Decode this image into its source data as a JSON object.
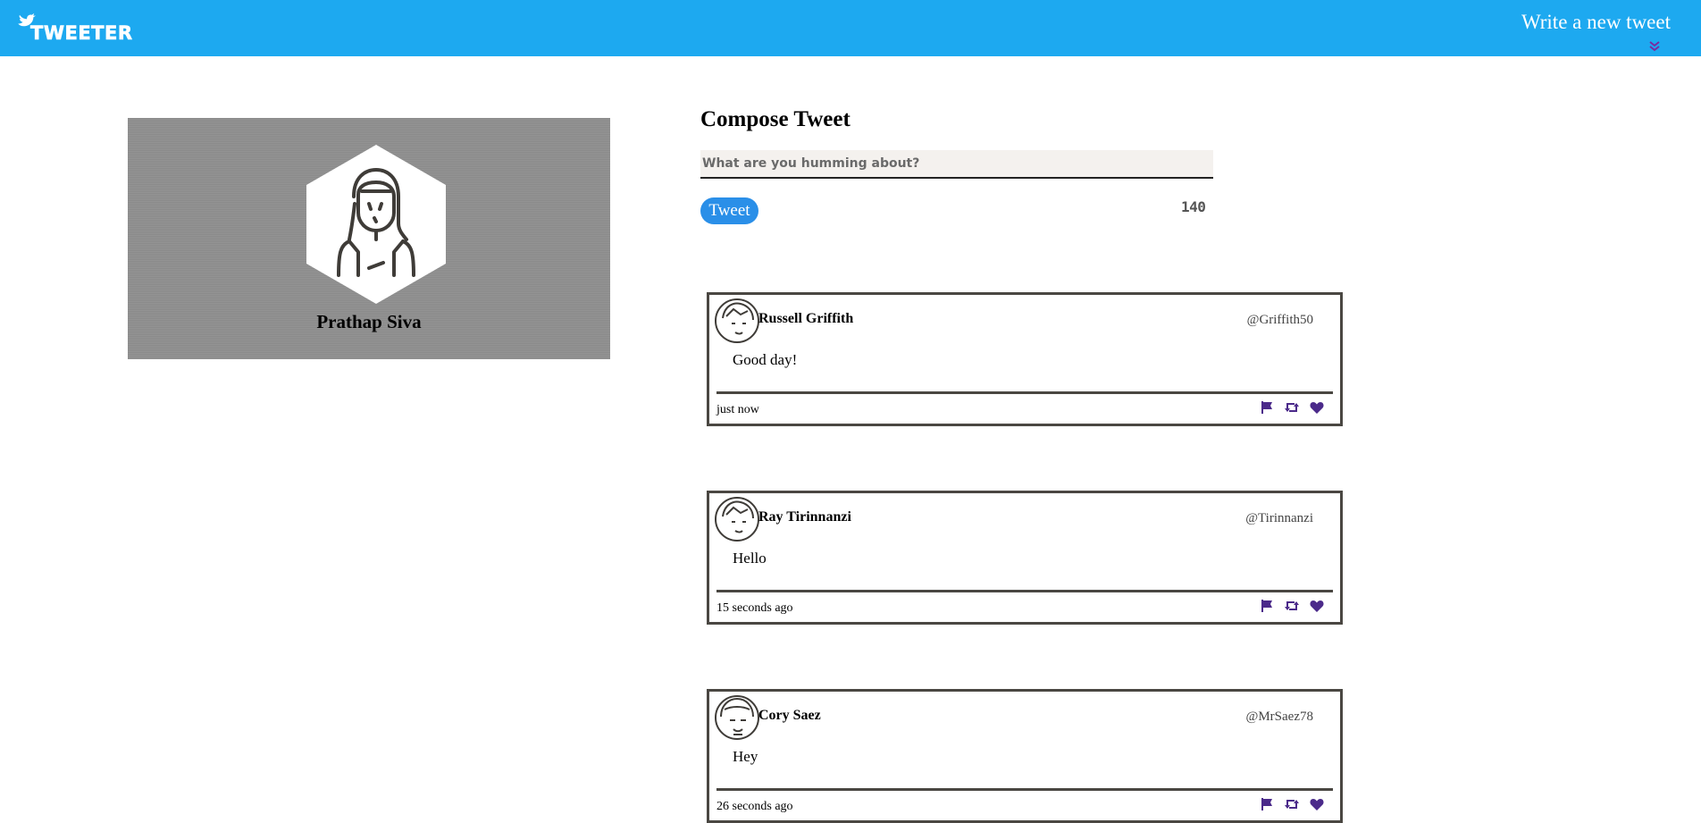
{
  "nav": {
    "brand": "TWEETER",
    "write_link": "Write a new tweet",
    "colors": {
      "bar": "#1da9f0",
      "arrow": "#7a2aa0"
    }
  },
  "profile": {
    "name": "Prathap Siva"
  },
  "compose": {
    "title": "Compose Tweet",
    "placeholder": "What are you humming about?",
    "value": "",
    "button_label": "Tweet",
    "char_count": "140"
  },
  "tweets": [
    {
      "name": "Russell Griffith",
      "handle": "@Griffith50",
      "body": "Good day!",
      "time": "just now"
    },
    {
      "name": "Ray Tirinnanzi",
      "handle": "@Tirinnanzi",
      "body": "Hello",
      "time": "15 seconds ago"
    },
    {
      "name": "Cory Saez",
      "handle": "@MrSaez78",
      "body": "Hey",
      "time": "26 seconds ago"
    }
  ],
  "icons": [
    "bird-icon",
    "double-chevron-down-icon",
    "flag-icon",
    "retweet-icon",
    "heart-icon"
  ],
  "colors": {
    "action_icon": "#4b2a8a",
    "tweet_button": "#2a8fe8",
    "border": "#4a4742"
  }
}
